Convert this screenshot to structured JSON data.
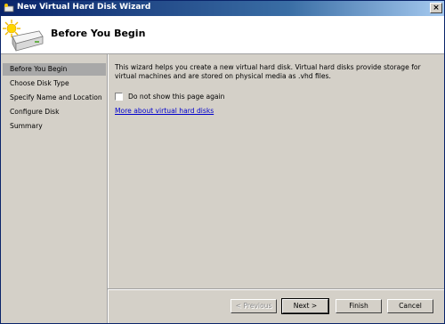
{
  "window": {
    "title": "New Virtual Hard Disk Wizard",
    "close_label": "×"
  },
  "header": {
    "title": "Before You Begin"
  },
  "sidebar": {
    "items": [
      {
        "label": "Before You Begin",
        "active": true
      },
      {
        "label": "Choose Disk Type",
        "active": false
      },
      {
        "label": "Specify Name and Location",
        "active": false
      },
      {
        "label": "Configure Disk",
        "active": false
      },
      {
        "label": "Summary",
        "active": false
      }
    ]
  },
  "content": {
    "description": "This wizard helps you create a new virtual hard disk. Virtual hard disks provide storage for virtual machines and are stored on physical media as .vhd files.",
    "checkbox_label": "Do not show this page again",
    "checkbox_checked": false,
    "more_link": "More about virtual hard disks"
  },
  "buttons": {
    "previous": "< Previous",
    "next": "Next >",
    "finish": "Finish",
    "cancel": "Cancel"
  },
  "icons": {
    "title": "disk-icon",
    "header": "disk-sun-icon"
  }
}
